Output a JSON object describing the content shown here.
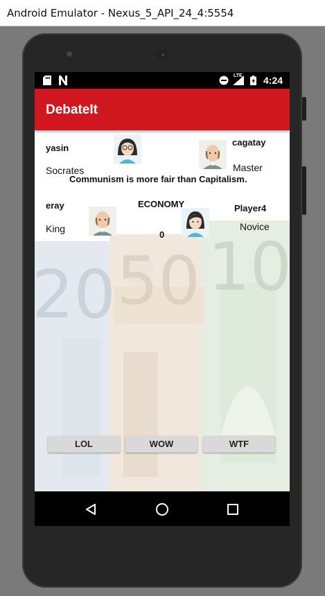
{
  "window": {
    "title": "Android Emulator - Nexus_5_API_24_4:5554"
  },
  "status_bar": {
    "time": "4:24",
    "network_label": "LTE"
  },
  "app": {
    "title": "DebateIt"
  },
  "players": [
    {
      "name": "yasin",
      "rank": "Socrates",
      "avatar": "female-glasses-avatar"
    },
    {
      "name": "cagatay",
      "rank": "Master",
      "avatar": "bald-man-avatar"
    },
    {
      "name": "eray",
      "rank": "King",
      "avatar": "bald-man-avatar"
    },
    {
      "name": "Player4",
      "rank": "Novice",
      "avatar": "female-avatar"
    }
  ],
  "debate": {
    "topic": "Communism is more fair than Capitalism.",
    "category": "ECONOMY",
    "score": "0"
  },
  "reactions": [
    "LOL",
    "WOW",
    "WTF"
  ],
  "colors": {
    "app_bar": "#d0161e",
    "background": "#ffffff",
    "button": "#d9d9d9"
  },
  "nav_icons": [
    "back-icon",
    "home-icon",
    "recents-icon"
  ]
}
